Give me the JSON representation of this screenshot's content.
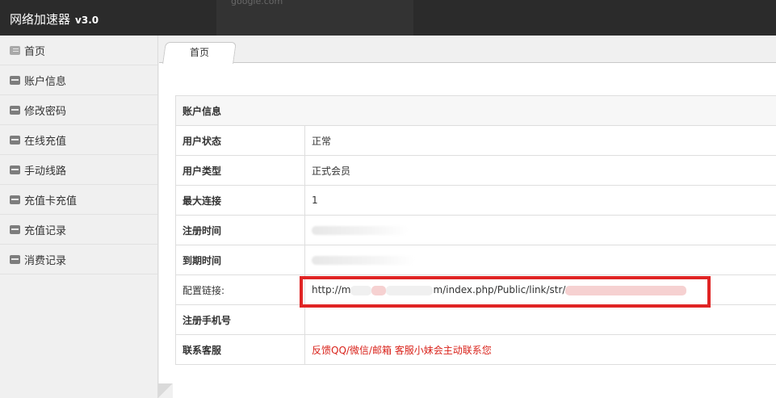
{
  "app": {
    "title": "网络加速器",
    "version": "v3.0"
  },
  "overlay": {
    "search_text": "google.com"
  },
  "sidebar": {
    "items": [
      {
        "label": "首页",
        "icon": "home-icon"
      },
      {
        "label": "账户信息",
        "icon": "minus-box-icon"
      },
      {
        "label": "修改密码",
        "icon": "minus-box-icon"
      },
      {
        "label": "在线充值",
        "icon": "minus-box-icon"
      },
      {
        "label": "手动线路",
        "icon": "minus-box-icon"
      },
      {
        "label": "充值卡充值",
        "icon": "minus-box-icon"
      },
      {
        "label": "充值记录",
        "icon": "minus-box-icon"
      },
      {
        "label": "消费记录",
        "icon": "minus-box-icon"
      }
    ]
  },
  "tabs": [
    {
      "label": "首页",
      "active": true
    }
  ],
  "account": {
    "header": "账户信息",
    "rows": [
      {
        "key": "用户状态",
        "value": "正常"
      },
      {
        "key": "用户类型",
        "value": "正式会员"
      },
      {
        "key": "最大连接",
        "value": "1"
      },
      {
        "key": "注册时间",
        "value": ""
      },
      {
        "key": "到期时间",
        "value": ""
      },
      {
        "key": "配置链接:",
        "value_prefix": "http://m",
        "value_mid": "m/index.php/Public/link/str/",
        "value_suffix": ""
      },
      {
        "key": "注册手机号",
        "value": ""
      },
      {
        "key": "联系客服",
        "value": "反馈QQ/微信/邮箱 客服小妹会主动联系您"
      }
    ]
  },
  "colors": {
    "topbar": "#2b2b2b",
    "highlight": "#e02424",
    "support_text": "#d9221a"
  }
}
